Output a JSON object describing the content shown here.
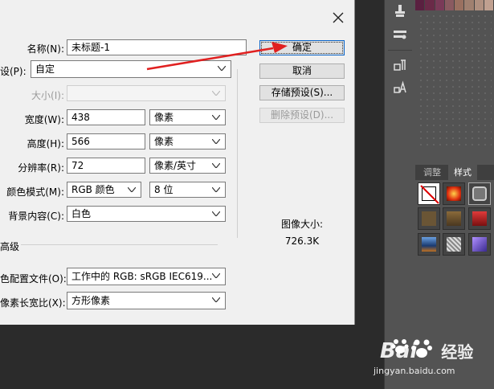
{
  "dialog": {
    "name_label": "名称(N):",
    "name_value": "未标题-1",
    "preset_label": "设(P):",
    "preset_value": "自定",
    "size_label": "大小(I):",
    "size_value": "",
    "width_label": "宽度(W):",
    "width_value": "438",
    "width_unit": "像素",
    "height_label": "高度(H):",
    "height_value": "566",
    "height_unit": "像素",
    "resolution_label": "分辨率(R):",
    "resolution_value": "72",
    "resolution_unit": "像素/英寸",
    "color_mode_label": "颜色模式(M):",
    "color_mode_value": "RGB 颜色",
    "bit_depth_value": "8 位",
    "background_label": "背景内容(C):",
    "background_value": "白色",
    "advanced_label": "高级",
    "color_profile_label": "色配置文件(O):",
    "color_profile_value": "工作中的 RGB: sRGB IEC619...",
    "pixel_aspect_label": "像素长宽比(X):",
    "pixel_aspect_value": "方形像素",
    "image_size_label": "图像大小:",
    "image_size_value": "726.3K"
  },
  "buttons": {
    "ok": "确定",
    "cancel": "取消",
    "save_preset": "存储预设(S)...",
    "delete_preset": "删除预设(D)..."
  },
  "panel": {
    "tab_adjustments": "调整",
    "tab_styles": "样式"
  },
  "watermark": {
    "brand_part1": "Bai",
    "brand_part2": "经验",
    "url": "jingyan.baidu.com"
  },
  "colors": {
    "annotation_arrow": "#e02020",
    "primary_button_border": "#0a64c8"
  },
  "icons": [
    "close-icon",
    "chevron-down-icon",
    "clone-stamp-icon",
    "brush-preset-icon",
    "character-panel-icon",
    "paragraph-panel-icon",
    "paw-icon"
  ]
}
